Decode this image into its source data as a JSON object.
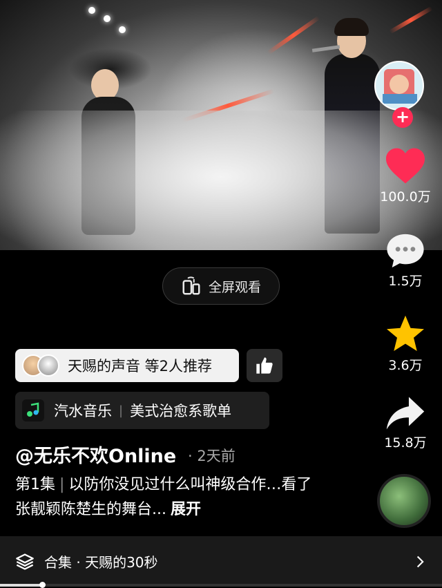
{
  "sidebar": {
    "likes": "100.0万",
    "comments": "1.5万",
    "favorites": "3.6万",
    "shares": "15.8万",
    "follow_symbol": "+"
  },
  "fullscreen": {
    "label": "全屏观看"
  },
  "recommend": {
    "text": "天赐的声音 等2人推荐"
  },
  "music": {
    "app": "汽水音乐",
    "playlist": "美式治愈系歌单",
    "separator": "|"
  },
  "author": {
    "handle": "@无乐不欢Online",
    "time": "· 2天前"
  },
  "description": {
    "episode": "第1集",
    "separator": "|",
    "text": "以防你没见过什么叫神级合作…看了张靓颖陈楚生的舞台...",
    "expand": "展开"
  },
  "collection": {
    "label": "合集 · 天赐的30秒"
  },
  "playback": {
    "progress_fraction": 0.095
  },
  "colors": {
    "like": "#fe2c55",
    "star": "#ffc300",
    "accent": "#fe2c55"
  }
}
